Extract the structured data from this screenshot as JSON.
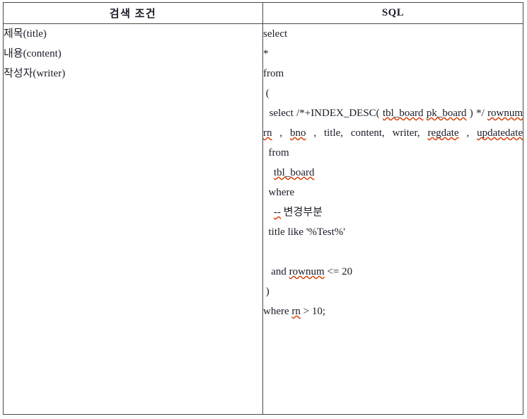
{
  "document": {
    "title": "검색 조건 / SQL 표",
    "text_color": "#1b1b28",
    "border_color": "#4a4a4a",
    "spellcheck_underline_color": "#d2420c",
    "background": "#ffffff"
  },
  "table": {
    "headers": {
      "condition": "검색 조건",
      "sql": "SQL"
    },
    "conditions": [
      {
        "label": "제목(title)"
      },
      {
        "label": "내용(content)"
      },
      {
        "label": "작성자(writer)"
      }
    ],
    "sql": {
      "full_text": "select\n*\nfrom\n (\n  select      /*+INDEX_DESC(tbl_board pk_board) */ rownum rn, bno, title, content, writer, regdate, updatedate\n  from\n    tbl_board\n  where\n    -- 변경부분\n  title like '%Test%'\n\n  and rownum <= 20\n )\nwhere rn > 10;",
      "lines": [
        {
          "id": "l1",
          "text": "select",
          "type": "line"
        },
        {
          "id": "l2",
          "text": "*",
          "type": "line"
        },
        {
          "id": "l3",
          "text": "from",
          "type": "line"
        },
        {
          "id": "l4",
          "text": " (",
          "type": "line"
        },
        {
          "id": "l5",
          "type": "paragraph",
          "segments": [
            {
              "text": "  select",
              "squiggle": false
            },
            {
              "text": "/*+INDEX_DESC(",
              "squiggle": false
            },
            {
              "text": "tbl_board",
              "squiggle": true
            },
            {
              "text": "pk_board",
              "squiggle": true
            },
            {
              "text": ") */",
              "squiggle": false
            },
            {
              "text": "rownum",
              "squiggle": true
            },
            {
              "text": "rn",
              "squiggle": true
            },
            {
              "text": ",",
              "squiggle": false
            },
            {
              "text": "bno",
              "squiggle": true
            },
            {
              "text": ",",
              "squiggle": false
            },
            {
              "text": "title,",
              "squiggle": false
            },
            {
              "text": "content,",
              "squiggle": false
            },
            {
              "text": "writer,",
              "squiggle": false
            },
            {
              "text": "regdate",
              "squiggle": true
            },
            {
              "text": ",",
              "squiggle": false
            },
            {
              "text": "updatedate",
              "squiggle": true
            }
          ]
        },
        {
          "id": "l6",
          "text": "  from",
          "type": "line"
        },
        {
          "id": "l7",
          "text": "    tbl_board",
          "type": "line",
          "squiggle_word": "tbl_board"
        },
        {
          "id": "l8",
          "text": "  where",
          "type": "line"
        },
        {
          "id": "l9",
          "text": "    -- 변경부분",
          "type": "line",
          "squiggle_word": "--"
        },
        {
          "id": "l10",
          "text": "  title like '%Test%'",
          "type": "line"
        },
        {
          "id": "l11",
          "text": "",
          "type": "blank"
        },
        {
          "id": "l12",
          "text": "   and rownum <= 20",
          "type": "line",
          "squiggle_word": "rownum"
        },
        {
          "id": "l13",
          "text": " )",
          "type": "line"
        },
        {
          "id": "l14",
          "text": "where rn > 10;",
          "type": "line",
          "squiggle_word": "rn"
        }
      ]
    }
  }
}
